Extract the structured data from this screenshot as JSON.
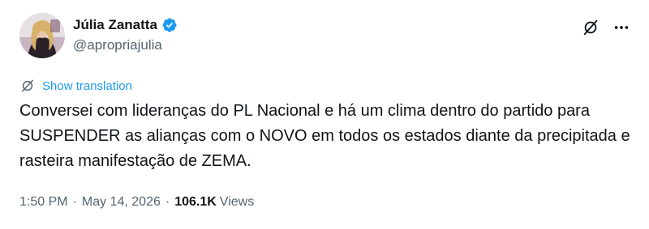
{
  "author": {
    "display_name": "Júlia Zanatta",
    "handle": "@apropriajulia",
    "verified": true
  },
  "translate": {
    "label": "Show translation"
  },
  "tweet": {
    "text": "Conversei com lideranças do PL Nacional e há um clima dentro do partido para SUSPENDER as alianças com o NOVO em todos os estados diante da precipitada e rasteira manifestação de ZEMA."
  },
  "meta": {
    "time": "1:50 PM",
    "date": "May 14, 2026",
    "separator": "·",
    "views_count": "106.1K",
    "views_label": "Views"
  },
  "icons": {
    "verified": "verified-badge-icon",
    "grok": "grok-icon",
    "more": "more-icon",
    "translate": "translate-icon"
  },
  "colors": {
    "accent": "#1d9bf0",
    "text_primary": "#0f1419",
    "text_secondary": "#536471"
  }
}
